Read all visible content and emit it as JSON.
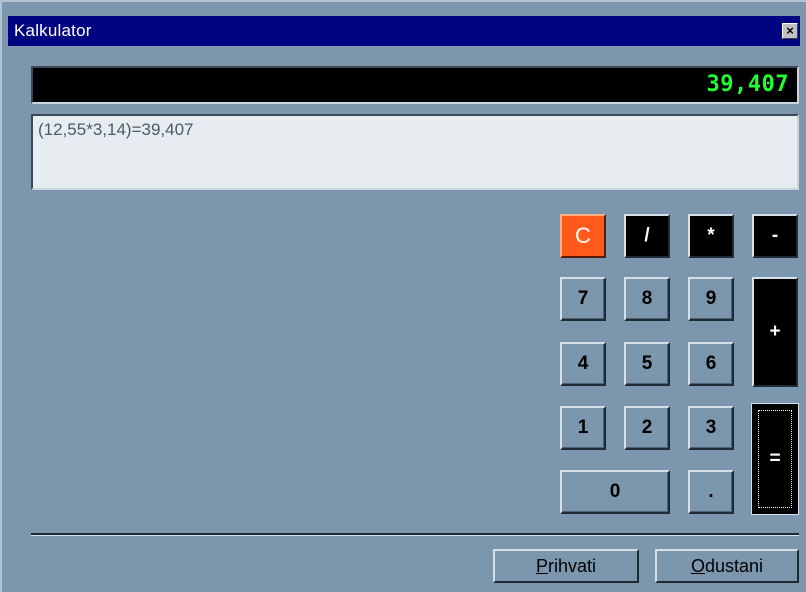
{
  "window": {
    "title": "Kalkulator",
    "close_glyph": "×"
  },
  "display": {
    "value": "39,407",
    "color": "#20ff30"
  },
  "history": {
    "text": "(12,55*3,14)=39,407"
  },
  "keypad": {
    "clear": "C",
    "divide": "/",
    "multiply": "*",
    "minus": "-",
    "plus": "+",
    "equals": "=",
    "seven": "7",
    "eight": "8",
    "nine": "9",
    "four": "4",
    "five": "5",
    "six": "6",
    "one": "1",
    "two": "2",
    "three": "3",
    "zero": "0",
    "decimal": ".",
    "clear_color": "#ff5a1a"
  },
  "footer": {
    "accept_first": "P",
    "accept_rest": "rihvati",
    "cancel_first": "O",
    "cancel_rest": "dustani"
  }
}
